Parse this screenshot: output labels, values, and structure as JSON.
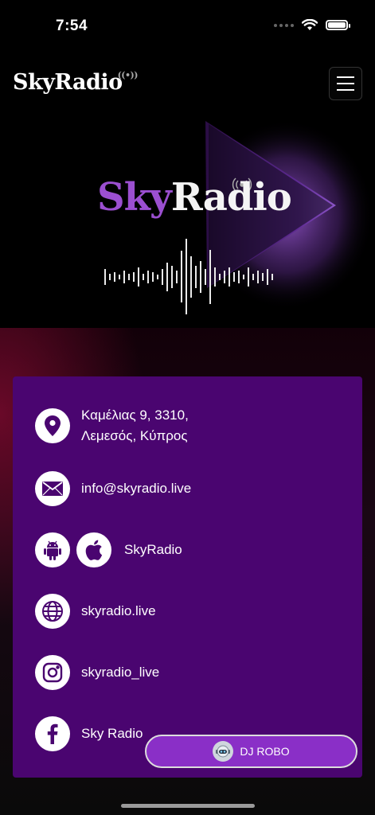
{
  "status_bar": {
    "time": "7:54"
  },
  "header": {
    "logo_text": "SkyRadio",
    "menu_icon": "hamburger-menu-icon"
  },
  "hero": {
    "logo_sky": "Sky",
    "logo_radio": "Radio"
  },
  "contact": {
    "address_line1": "Καμέλιας 9, 3310,",
    "address_line2": "Λεμεσός, Κύπρος",
    "email": "info@skyradio.live",
    "app_label": "SkyRadio",
    "website": "skyradio.live",
    "instagram": "skyradio_live",
    "facebook": "Sky Radio"
  },
  "dj_button": {
    "label": "DJ ROBO"
  },
  "colors": {
    "card_bg": "#4a0570",
    "accent_purple": "#8a2fc7",
    "logo_purple": "#9b4fd0"
  }
}
